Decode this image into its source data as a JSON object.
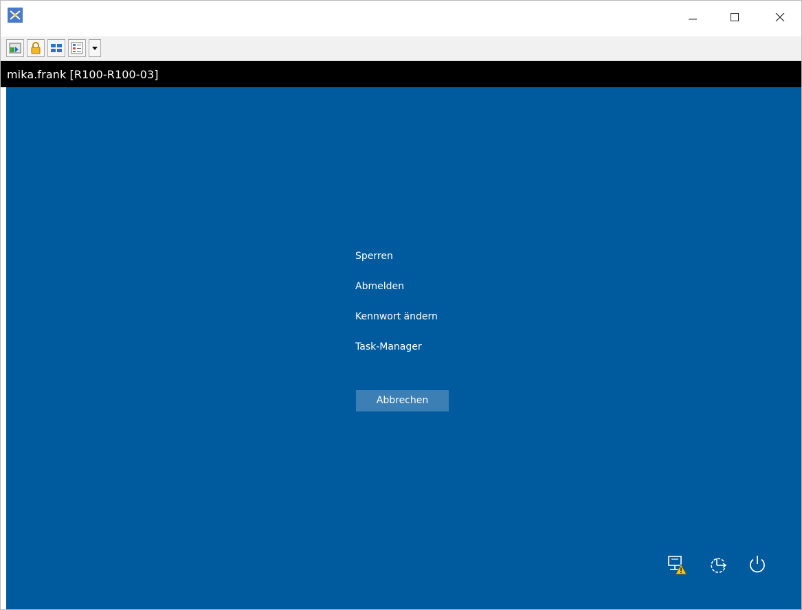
{
  "window": {
    "controls": {
      "minimize_icon": "minimize-icon",
      "maximize_icon": "maximize-icon",
      "close_icon": "close-icon"
    }
  },
  "toolbar": {
    "buttons": [
      "transfer-icon",
      "lock-icon",
      "tile-windows-icon",
      "list-view-icon"
    ],
    "dropdown_icon": "chevron-down-icon"
  },
  "session": {
    "title": "mika.frank [R100-R100-03]"
  },
  "security_screen": {
    "background_color": "#005a9e",
    "options": [
      "Sperren",
      "Abmelden",
      "Kennwort ändern",
      "Task-Manager"
    ],
    "cancel_label": "Abbrechen"
  },
  "tray": {
    "icons": [
      "network-warning-icon",
      "ease-of-access-icon",
      "power-icon"
    ]
  }
}
